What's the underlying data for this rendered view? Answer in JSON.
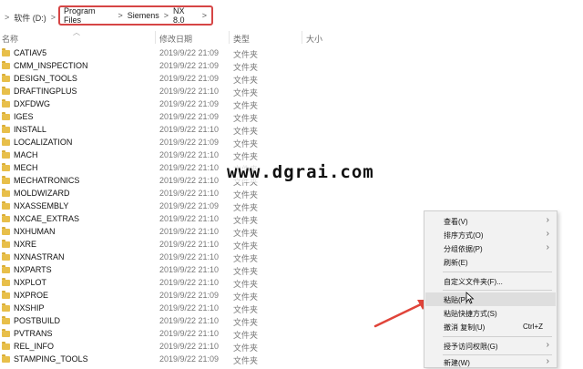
{
  "addressbar": {
    "prefix": [
      ">",
      "软件 (D:)",
      ">"
    ],
    "crumbs": [
      "Program Files",
      "Siemens",
      "NX 8.0"
    ],
    "trail": ">"
  },
  "columns": {
    "name": "名称",
    "date": "修改日期",
    "type": "类型",
    "size": "大小"
  },
  "rows": [
    {
      "name": "CATIAV5",
      "date": "2019/9/22 21:09",
      "type": "文件夹"
    },
    {
      "name": "CMM_INSPECTION",
      "date": "2019/9/22 21:09",
      "type": "文件夹"
    },
    {
      "name": "DESIGN_TOOLS",
      "date": "2019/9/22 21:09",
      "type": "文件夹"
    },
    {
      "name": "DRAFTINGPLUS",
      "date": "2019/9/22 21:10",
      "type": "文件夹"
    },
    {
      "name": "DXFDWG",
      "date": "2019/9/22 21:09",
      "type": "文件夹"
    },
    {
      "name": "IGES",
      "date": "2019/9/22 21:09",
      "type": "文件夹"
    },
    {
      "name": "INSTALL",
      "date": "2019/9/22 21:10",
      "type": "文件夹"
    },
    {
      "name": "LOCALIZATION",
      "date": "2019/9/22 21:09",
      "type": "文件夹"
    },
    {
      "name": "MACH",
      "date": "2019/9/22 21:10",
      "type": "文件夹"
    },
    {
      "name": "MECH",
      "date": "2019/9/22 21:10",
      "type": "文件夹"
    },
    {
      "name": "MECHATRONICS",
      "date": "2019/9/22 21:10",
      "type": "文件夹"
    },
    {
      "name": "MOLDWIZARD",
      "date": "2019/9/22 21:10",
      "type": "文件夹"
    },
    {
      "name": "NXASSEMBLY",
      "date": "2019/9/22 21:09",
      "type": "文件夹"
    },
    {
      "name": "NXCAE_EXTRAS",
      "date": "2019/9/22 21:10",
      "type": "文件夹"
    },
    {
      "name": "NXHUMAN",
      "date": "2019/9/22 21:10",
      "type": "文件夹"
    },
    {
      "name": "NXRE",
      "date": "2019/9/22 21:10",
      "type": "文件夹"
    },
    {
      "name": "NXNASTRAN",
      "date": "2019/9/22 21:10",
      "type": "文件夹"
    },
    {
      "name": "NXPARTS",
      "date": "2019/9/22 21:10",
      "type": "文件夹"
    },
    {
      "name": "NXPLOT",
      "date": "2019/9/22 21:10",
      "type": "文件夹"
    },
    {
      "name": "NXPROE",
      "date": "2019/9/22 21:09",
      "type": "文件夹"
    },
    {
      "name": "NXSHIP",
      "date": "2019/9/22 21:10",
      "type": "文件夹"
    },
    {
      "name": "POSTBUILD",
      "date": "2019/9/22 21:10",
      "type": "文件夹"
    },
    {
      "name": "PVTRANS",
      "date": "2019/9/22 21:10",
      "type": "文件夹"
    },
    {
      "name": "REL_INFO",
      "date": "2019/9/22 21:10",
      "type": "文件夹"
    },
    {
      "name": "STAMPING_TOOLS",
      "date": "2019/9/22 21:09",
      "type": "文件夹"
    }
  ],
  "watermark": "www.dgrai.com",
  "context_menu": {
    "view": "查看(V)",
    "sort": "排序方式(O)",
    "group": "分组依据(P)",
    "refresh": "刷新(E)",
    "customize": "自定义文件夹(F)...",
    "paste": "粘贴(P)",
    "paste_shortcut": "粘贴快捷方式(S)",
    "undo_copy": "撤消 复制(U)",
    "undo_shortcut": "Ctrl+Z",
    "grant_access": "授予访问权限(G)",
    "new": "新建(W)"
  },
  "colors": {
    "highlight_box": "#d64545",
    "arrow": "#e0443a",
    "folder": "#e8bf4a"
  }
}
